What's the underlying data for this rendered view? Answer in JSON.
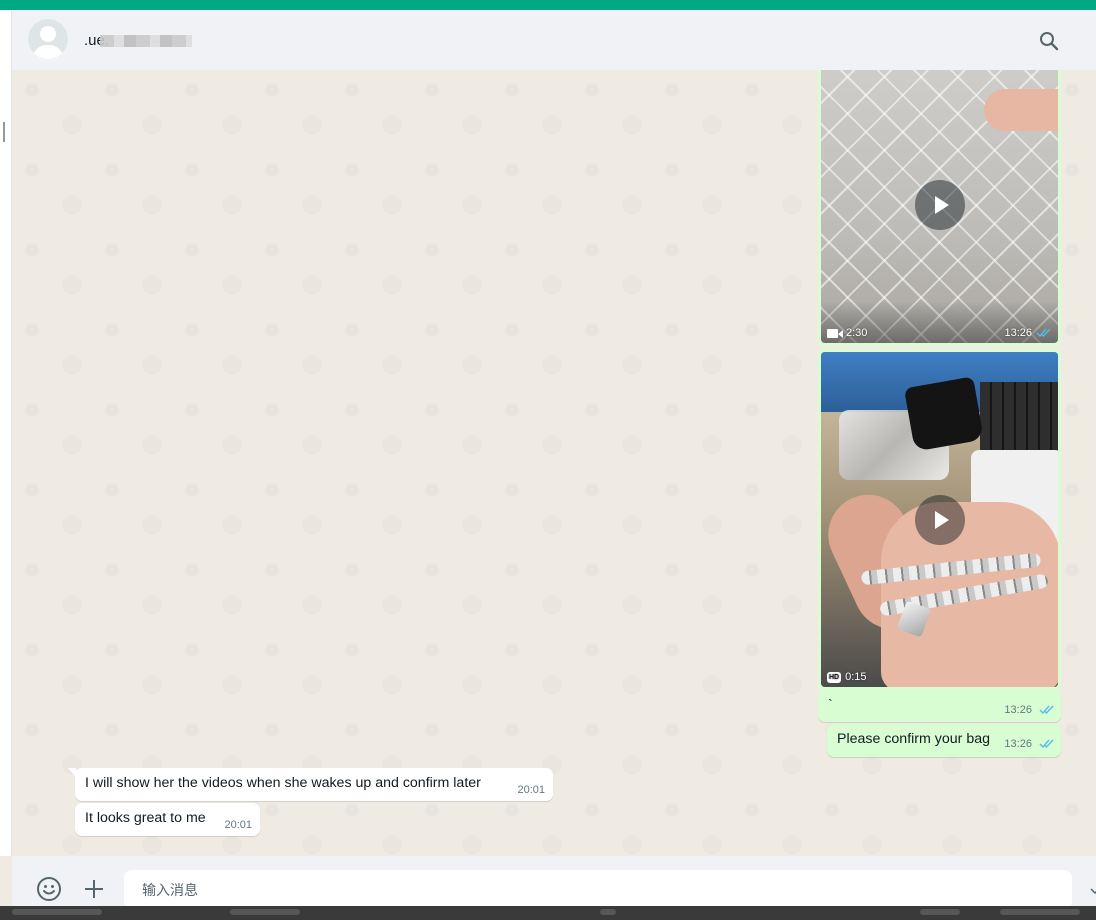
{
  "header": {
    "contact_name": ".ue.",
    "search_icon": "search-icon"
  },
  "messages": {
    "video1": {
      "duration": "2:30",
      "time": "13:26",
      "status": "read",
      "icon": "video-camera-icon"
    },
    "video2": {
      "duration": "0:15",
      "time": "13:26",
      "status": "read",
      "badge": "HD"
    },
    "out_small": {
      "text": "`",
      "time": "13:26",
      "status": "read"
    },
    "out_confirm": {
      "text": "Please confirm your bag",
      "time": "13:26",
      "status": "read"
    },
    "in1": {
      "text": "I will show her the videos when she wakes up and confirm later",
      "time": "20:01"
    },
    "in2": {
      "text": "It looks great to me",
      "time": "20:01"
    }
  },
  "composer": {
    "placeholder": "输入消息",
    "emoji_icon": "emoji-icon",
    "attach_icon": "plus-icon"
  },
  "colors": {
    "accent": "#00a884",
    "outgoing_bubble": "#d9fdd3",
    "incoming_bubble": "#ffffff",
    "chat_bg": "#efeae2",
    "read_ticks": "#53bdeb"
  }
}
